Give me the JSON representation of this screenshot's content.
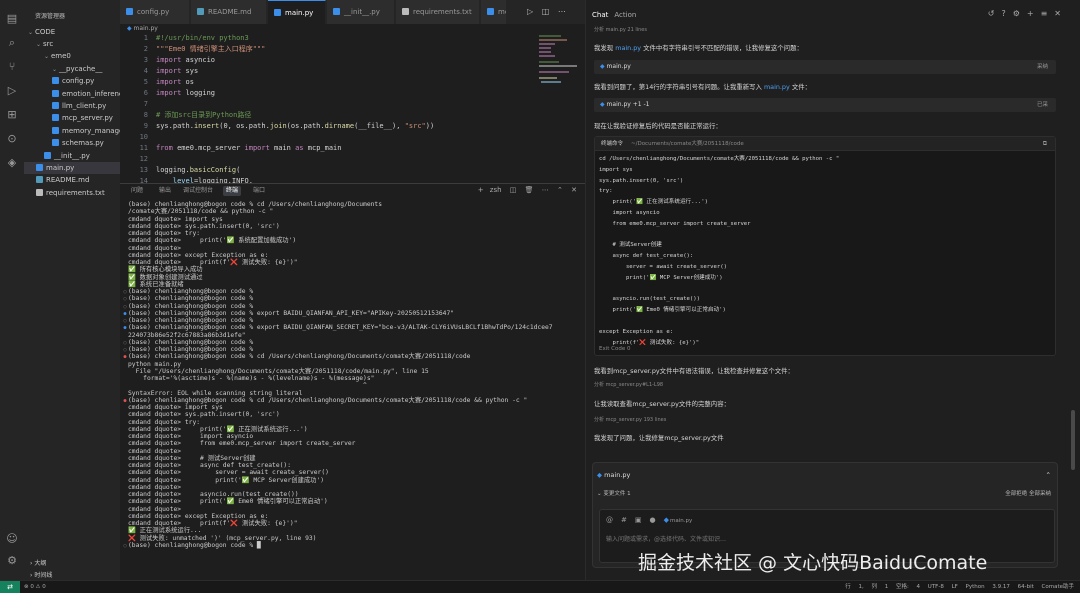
{
  "sidebar": {
    "header": "资源管理器",
    "root": "CODE",
    "items": [
      {
        "label": "src",
        "depth": 1,
        "type": "folder"
      },
      {
        "label": "eme0",
        "depth": 2,
        "type": "folder"
      },
      {
        "label": "__pycache__",
        "depth": 3,
        "type": "folder"
      },
      {
        "label": "config.py",
        "depth": 3,
        "type": "py"
      },
      {
        "label": "emotion_inferenc...",
        "depth": 3,
        "type": "py"
      },
      {
        "label": "llm_client.py",
        "depth": 3,
        "type": "py"
      },
      {
        "label": "mcp_server.py",
        "depth": 3,
        "type": "py"
      },
      {
        "label": "memory_manager...",
        "depth": 3,
        "type": "py"
      },
      {
        "label": "schemas.py",
        "depth": 3,
        "type": "py"
      },
      {
        "label": "__init__.py",
        "depth": 2,
        "type": "py"
      },
      {
        "label": "main.py",
        "depth": 1,
        "type": "py",
        "selected": true
      },
      {
        "label": "README.md",
        "depth": 1,
        "type": "md"
      },
      {
        "label": "requirements.txt",
        "depth": 1,
        "type": "txt"
      }
    ],
    "outline": "大纲",
    "timeline": "时间线"
  },
  "tabs": [
    {
      "label": "config.py",
      "type": "py"
    },
    {
      "label": "README.md",
      "type": "md"
    },
    {
      "label": "main.py",
      "type": "py",
      "active": true
    },
    {
      "label": "__init__.py",
      "type": "py"
    },
    {
      "label": "requirements.txt",
      "type": "txt"
    },
    {
      "label": "mcp",
      "type": "py"
    }
  ],
  "breadcrumb": "main.py",
  "editor_lines": [
    [
      [
        "c-comment",
        "#!/usr/bin/env python3"
      ]
    ],
    [
      [
        "c-str",
        "\"\"\"Eme0 情绪引擎主入口程序\"\"\""
      ]
    ],
    [
      [
        "c-kw",
        "import "
      ],
      [
        "c-plain",
        "asyncio"
      ]
    ],
    [
      [
        "c-kw",
        "import "
      ],
      [
        "c-plain",
        "sys"
      ]
    ],
    [
      [
        "c-kw",
        "import "
      ],
      [
        "c-plain",
        "os"
      ]
    ],
    [
      [
        "c-kw",
        "import "
      ],
      [
        "c-plain",
        "logging"
      ]
    ],
    [
      [
        "c-plain",
        ""
      ]
    ],
    [
      [
        "c-comment",
        "# 添加src目录到Python路径"
      ]
    ],
    [
      [
        "c-plain",
        "sys.path."
      ],
      [
        "c-fn",
        "insert"
      ],
      [
        "c-plain",
        "(0, os.path."
      ],
      [
        "c-fn",
        "join"
      ],
      [
        "c-plain",
        "(os.path."
      ],
      [
        "c-fn",
        "dirname"
      ],
      [
        "c-plain",
        "(__file__), "
      ],
      [
        "c-str",
        "\"src\""
      ],
      [
        "c-plain",
        "))"
      ]
    ],
    [
      [
        "c-plain",
        ""
      ]
    ],
    [
      [
        "c-kw",
        "from "
      ],
      [
        "c-plain",
        "eme0.mcp_server "
      ],
      [
        "c-kw",
        "import "
      ],
      [
        "c-plain",
        "main "
      ],
      [
        "c-kw",
        "as "
      ],
      [
        "c-plain",
        "mcp_main"
      ]
    ],
    [
      [
        "c-plain",
        ""
      ]
    ],
    [
      [
        "c-plain",
        "logging."
      ],
      [
        "c-fn",
        "basicConfig"
      ],
      [
        "c-plain",
        "("
      ]
    ],
    [
      [
        "c-plain",
        "    "
      ],
      [
        "c-var",
        "level"
      ],
      [
        "c-plain",
        "=logging.INFO,"
      ]
    ]
  ],
  "panel": {
    "tabs": [
      "问题",
      "输出",
      "调试控制台",
      "终端",
      "端口"
    ],
    "active_tab": "终端",
    "shell_label": "zsh"
  },
  "terminal_lines": [
    [
      "",
      "(base) chenlianghong@bogon code % cd /Users/chenlianghong/Documents"
    ],
    [
      "",
      "/comate大赛/2051118/code && python -c \""
    ],
    [
      "",
      "cmdand dquote> import sys"
    ],
    [
      "",
      "cmdand dquote> sys.path.insert(0, 'src')"
    ],
    [
      "",
      "cmdand dquote> try:"
    ],
    [
      "",
      "cmdand dquote>     print('✅ 系统配置加载成功')"
    ],
    [
      "",
      "cmdand dquote>"
    ],
    [
      "",
      "cmdand dquote> except Exception as e:"
    ],
    [
      "",
      "cmdand dquote>     print(f'❌ 测试失败: {e}')\""
    ],
    [
      "",
      "✅ 所有核心模块导入成功"
    ],
    [
      "",
      "✅ 数据对象创建测试通过"
    ],
    [
      "",
      "✅ 系统已准备就绪"
    ],
    [
      "gray",
      "(base) chenlianghong@bogon code %"
    ],
    [
      "gray",
      "(base) chenlianghong@bogon code %"
    ],
    [
      "gray",
      "(base) chenlianghong@bogon code %"
    ],
    [
      "blue",
      "(base) chenlianghong@bogon code % export BAIDU_QIANFAN_API_KEY=\"APIKey-20250512153647\""
    ],
    [
      "gray",
      "(base) chenlianghong@bogon code %"
    ],
    [
      "blue",
      "(base) chenlianghong@bogon code % export BAIDU_QIANFAN_SECRET_KEY=\"bce-v3/ALTAK-CLY6iVUsLBCLf1BhwTdPo/124c1dcee7"
    ],
    [
      "",
      "224073b86e52f2c67883a86b3d1efe\""
    ],
    [
      "gray",
      "(base) chenlianghong@bogon code %"
    ],
    [
      "gray",
      "(base) chenlianghong@bogon code %"
    ],
    [
      "red",
      "(base) chenlianghong@bogon code % cd /Users/chenlianghong/Documents/comate大赛/2051118/code"
    ],
    [
      "",
      "python main.py"
    ],
    [
      "",
      "  File \"/Users/chenlianghong/Documents/comate大赛/2051118/code/main.py\", line 15"
    ],
    [
      "",
      "    format='%(asctime)s - %(name)s - %(levelname)s - %(message)s\""
    ],
    [
      "",
      "                                                              ^"
    ],
    [
      "",
      "SyntaxError: EOL while scanning string literal"
    ],
    [
      "red",
      "(base) chenlianghong@bogon code % cd /Users/chenlianghong/Documents/comate大赛/2051118/code && python -c \""
    ],
    [
      "",
      "cmdand dquote> import sys"
    ],
    [
      "",
      "cmdand dquote> sys.path.insert(0, 'src')"
    ],
    [
      "",
      "cmdand dquote> try:"
    ],
    [
      "",
      "cmdand dquote>     print('✅ 正在测试系统运行...')"
    ],
    [
      "",
      "cmdand dquote>     import asyncio"
    ],
    [
      "",
      "cmdand dquote>     from eme0.mcp_server import create_server"
    ],
    [
      "",
      "cmdand dquote>"
    ],
    [
      "",
      "cmdand dquote>     # 测试Server创建"
    ],
    [
      "",
      "cmdand dquote>     async def test_create():"
    ],
    [
      "",
      "cmdand dquote>         server = await create_server()"
    ],
    [
      "",
      "cmdand dquote>         print('✅ MCP Server创建成功')"
    ],
    [
      "",
      "cmdand dquote>"
    ],
    [
      "",
      "cmdand dquote>     asyncio.run(test_create())"
    ],
    [
      "",
      "cmdand dquote>     print('✅ Eme0 情绪引擎可以正常启动')"
    ],
    [
      "",
      "cmdand dquote>"
    ],
    [
      "",
      "cmdand dquote> except Exception as e:"
    ],
    [
      "",
      "cmdand dquote>     print(f'❌ 测试失败: {e}')\""
    ],
    [
      "",
      "✅ 正在测试系统运行..."
    ],
    [
      "",
      "❌ 测试失败: unmatched ')' (mcp_server.py, line 93)"
    ],
    [
      "gray",
      "(base) chenlianghong@bogon code % █"
    ]
  ],
  "chat": {
    "tabs": [
      "Chat",
      "Action"
    ],
    "active_tab": "Chat",
    "header_note": "分析 main.py 21 lines",
    "msg1_pre": "我发现 ",
    "msg1_link": "main.py",
    "msg1_post": " 文件中有字符串引号不匹配的错误，让我修复这个问题：",
    "ref1_label": "main.py",
    "ref1_action": "采纳",
    "msg2_pre": "我看到问题了，第14行的字符串引号有问题。让我重新写入 ",
    "msg2_link": "main.py",
    "msg2_post": " 文件：",
    "ref2_label": "main.py  +1  -1",
    "ref2_action": "已采",
    "msg3": "现在让我验证修复后的代码是否能正常运行：",
    "cmd_title": "终端命令",
    "cmd_path": "~/Documents/comate大赛/2051118/code",
    "cmd_lines": [
      "cd /Users/chenlianghong/Documents/comate大赛/2051118/code && python -c \"",
      "import sys",
      "sys.path.insert(0, 'src')",
      "try:",
      "    print('✅ 正在测试系统运行...')",
      "    import asyncio",
      "    from eme0.mcp_server import create_server",
      "",
      "    # 测试Server创建",
      "    async def test_create():",
      "        server = await create_server()",
      "        print('✅ MCP Server创建成功')",
      "",
      "    asyncio.run(test_create())",
      "    print('✅ Eme0 情绪引擎可以正常启动')",
      "",
      "except Exception as e:",
      "    print(f'❌ 测试失败: {e}')\""
    ],
    "exit_code": "Exit Code 0",
    "msg4": "我看到mcp_server.py文件中有语法错误，让我检查并修复这个文件：",
    "note4": "分析 mcp_server.py#L1-L98",
    "msg5": "让我读取查看mcp_server.py文件的完整内容：",
    "note5": "分析 mcp_server.py 193 lines",
    "msg6": "我发现了问题，让我修复mcp_server.py文件",
    "input_file": "main.py",
    "input_sub_left": "变更文件 1",
    "input_sub_right": "全部拒绝   全部采纳",
    "input_tag": "main.py",
    "input_placeholder": "输入问题或需求，@选择代码、文件或知识…"
  },
  "watermark": "掘金技术社区 @ 文心快码BaiduComate",
  "status": {
    "left": "⊗ 0  ⚠ 0",
    "right": "行 1, 列 1  空格: 4  UTF-8  LF  Python  3.9.17 64-bit  Comate助手"
  }
}
